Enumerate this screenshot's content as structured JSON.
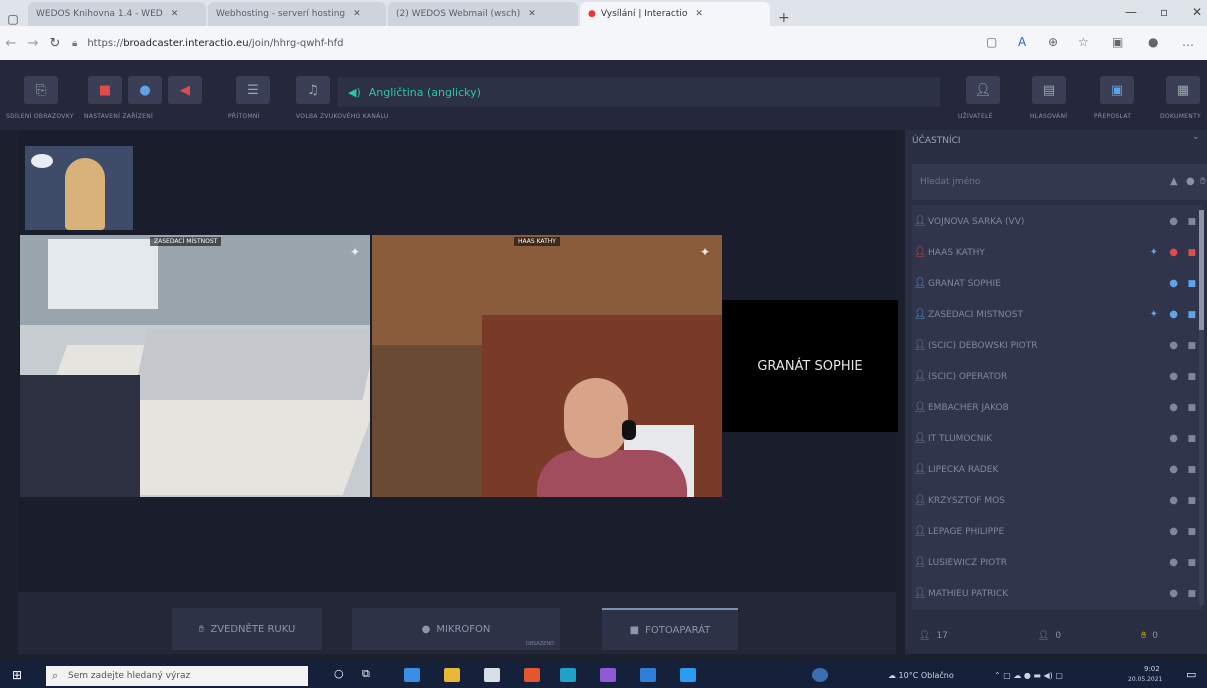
{
  "browser": {
    "tabs": [
      {
        "label": "WEDOS Knihovna 1.4 - WED",
        "active": false
      },
      {
        "label": "Webhosting - serverí hosting",
        "active": false
      },
      {
        "label": "(2) WEDOS Webmail (wsch)",
        "active": false
      },
      {
        "label": "Vysílání | Interactio",
        "active": true
      }
    ],
    "url_prefix": "https://",
    "url_host": "broadcaster.interactio.eu",
    "url_path": "/join/hhrg-qwhf-hfd"
  },
  "toolbar": {
    "labels": [
      "SDÍLENÍ OBRAZOVKY",
      "NASTAVENÍ ZAŘÍZENÍ",
      "PŘÍTOMNÍ",
      "VOLBA ZVUKOVÉHO KANÁLU",
      "UŽIVATELÉ",
      "HLASOVÁNÍ",
      "PŘEPOSLAT",
      "DOKUMENTY"
    ],
    "language_channel": "Angličtina (anglicky)"
  },
  "stage": {
    "tile1_name": "ZASEDACÍ MÍSTNOST",
    "tile2_name": "HAAS KATHY",
    "tile3_name": "GRANÁT SOPHIE"
  },
  "controls": {
    "raise_hand": "ZVEDNĚTE RUKU",
    "microphone": "MIKROFON",
    "microphone_sub": "OBSAZENO",
    "camera": "FOTOAPARÁT"
  },
  "panel": {
    "title": "ÚČASTNÍCI",
    "search_placeholder": "Hledat jméno",
    "participants": [
      {
        "name": "Vojnová Šárka (VV)",
        "color": "#7e879f",
        "pinned": false
      },
      {
        "name": "Haas Kathy",
        "color": "#e24b4b",
        "pinned": true
      },
      {
        "name": "Granát Sophie",
        "color": "#5fa3e8",
        "pinned": false
      },
      {
        "name": "Zasedací místnost",
        "color": "#5fa3e8",
        "pinned": true
      },
      {
        "name": "(SCIC) Debowski Piotr",
        "color": "#7e879f",
        "pinned": false
      },
      {
        "name": "(SCIC) Operator",
        "color": "#7e879f",
        "pinned": false
      },
      {
        "name": "Embacher Jakob",
        "color": "#7e879f",
        "pinned": false
      },
      {
        "name": "IT Tlumočník",
        "color": "#7e879f",
        "pinned": false
      },
      {
        "name": "Lipečka Radek",
        "color": "#7e879f",
        "pinned": false
      },
      {
        "name": "Krzysztof Moś",
        "color": "#7e879f",
        "pinned": false
      },
      {
        "name": "Lepage Philippe",
        "color": "#7e879f",
        "pinned": false
      },
      {
        "name": "Lusiewicz Piotr",
        "color": "#7e879f",
        "pinned": false
      },
      {
        "name": "Mathieu Patrick",
        "color": "#7e879f",
        "pinned": false
      }
    ],
    "count_users": "17",
    "count_mic": "0",
    "count_hand": "0"
  },
  "taskbar": {
    "search_placeholder": "Sem zadejte hledaný výraz",
    "weather": "10°C Oblačno",
    "time": "9:02",
    "date": "20.05.2021"
  },
  "colors": {
    "accent_teal": "#2ec6a0",
    "alert_red": "#e24b4b",
    "pin_blue": "#5fa3e8"
  }
}
